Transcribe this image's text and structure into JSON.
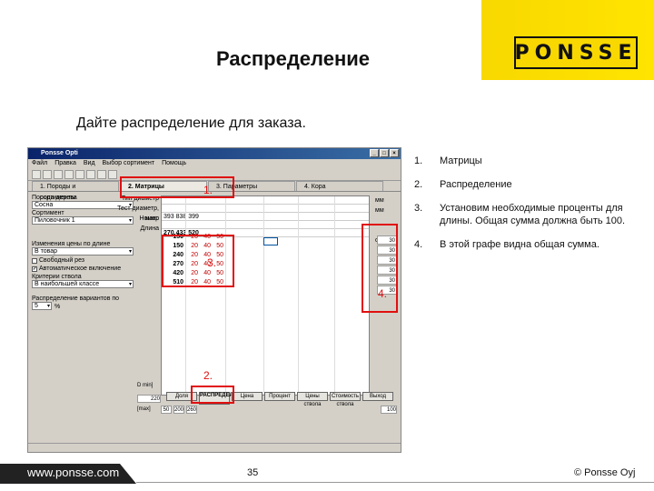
{
  "slide": {
    "title": "Распределение",
    "subtitle": "Дайте распределение для заказа.",
    "logo": "PONSSE",
    "footer_site": "www.ponsse.com",
    "page_number": "35",
    "copyright": "© Ponsse Oyj",
    "accent_color": "#f8d800",
    "callout_color": "#e01010"
  },
  "steps": [
    {
      "num": "1.",
      "text": "Матрицы"
    },
    {
      "num": "2.",
      "text": "Распределение"
    },
    {
      "num": "3.",
      "text": "Установим необходимые проценты для длины. Общая сумма должна быть 100."
    },
    {
      "num": "4.",
      "text": "В этой графе видна общая сумма."
    }
  ],
  "callouts": {
    "c1": "1.",
    "c2": "2.",
    "c3": "3.",
    "c4": "4."
  },
  "window": {
    "title": "Ponsse Opti",
    "menu": [
      "Файл",
      "Правка",
      "Вид",
      "Выбор сортимент",
      "Помощь"
    ],
    "tabs": [
      {
        "label": "1. Породы и сортименты"
      },
      {
        "label": "2. Матрицы"
      },
      {
        "label": "3. Параметры"
      },
      {
        "label": "4. Кора"
      }
    ],
    "left_pane": {
      "species_label": "Порода дерева",
      "species_value": "Сосна",
      "grade_label": "Сортимент",
      "grade_value": "Пиловочник 1",
      "price_label": "Изменения цены по длине",
      "price_value": "В товар",
      "free_check": "Свободный рез",
      "auto_check": "Автоматическое включение",
      "criteria_label": "Критерии ствола",
      "criteria_value": "В наибольшей классе",
      "dist_label": "Распределение вариантов по",
      "dist_value": "5",
      "dist_unit": "%"
    },
    "mid_labels": [
      "Тип диаметр",
      "Тест диаметр, макс",
      "Номер",
      "Длина"
    ],
    "input_rows": [
      "",
      "",
      "393   838   399",
      "",
      "270   433   520"
    ],
    "lengths": [
      "150",
      "150",
      "240",
      "270",
      "420",
      "510"
    ],
    "row_values": [
      "20",
      "40",
      "50"
    ],
    "units": [
      "мм",
      "мм",
      "см"
    ],
    "sums": [
      "30",
      "30",
      "30",
      "30",
      "30",
      "30"
    ],
    "bottom_buttons": [
      "Доля",
      "РАСПРЕДЕЛЕНИЕ",
      "Цена",
      "Процент",
      "Цены ствола",
      "Стоимость ствола",
      "Выход"
    ],
    "dmin_label": "D min]",
    "dmax_label": "[max]",
    "min_value": "220",
    "bottom_values": [
      "50",
      "200",
      "260"
    ],
    "total": "100"
  }
}
